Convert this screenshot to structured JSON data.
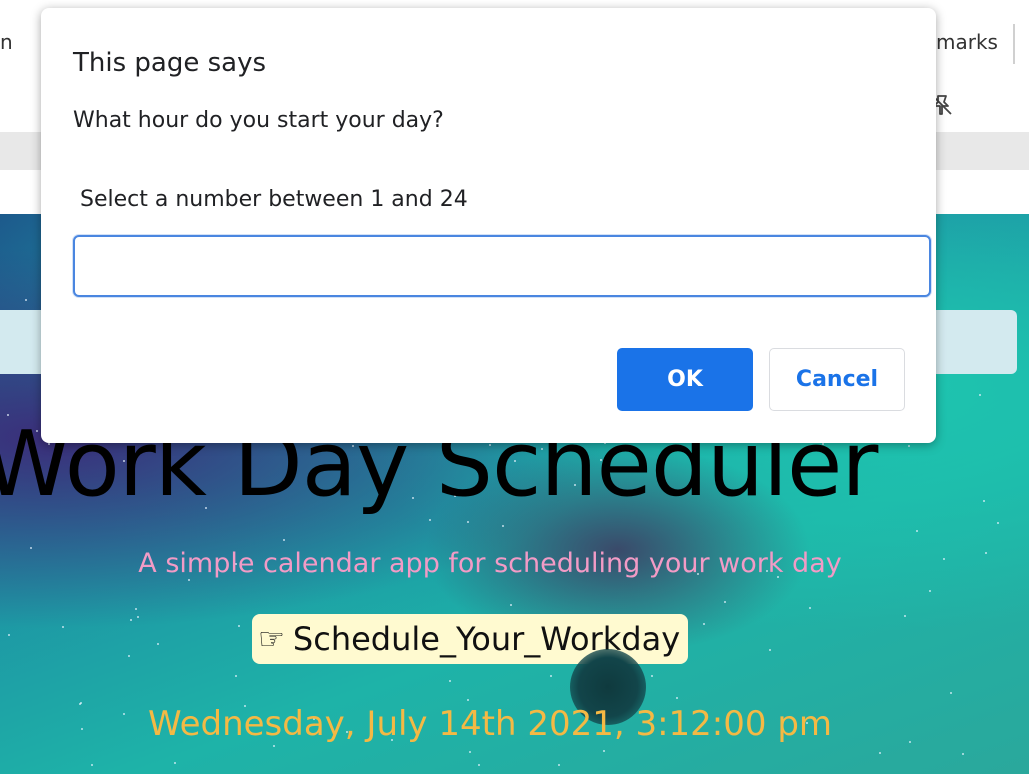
{
  "browser": {
    "tab_edge_text": "n",
    "bookmarks_label": "marks",
    "extension_icon": "pin-slash-icon"
  },
  "page": {
    "title": "Work Day Scheduler",
    "subtitle": "A simple calendar app for scheduling your work day",
    "schedule_link_icon": "thumbs-up-point-icon",
    "schedule_link_label": "Schedule_Your_Workday",
    "current_date": "Wednesday, July 14th 2021, 3:12:00 pm"
  },
  "dialog": {
    "title": "This page says",
    "message": "What hour do you start your day?",
    "hint": "Select a number between 1 and 24",
    "input_value": "",
    "ok_label": "OK",
    "cancel_label": "Cancel"
  },
  "colors": {
    "accent_blue": "#1a73e8",
    "subtitle_pink": "#f29bc6",
    "date_orange": "#f4b944",
    "link_bg": "#fffad0"
  }
}
